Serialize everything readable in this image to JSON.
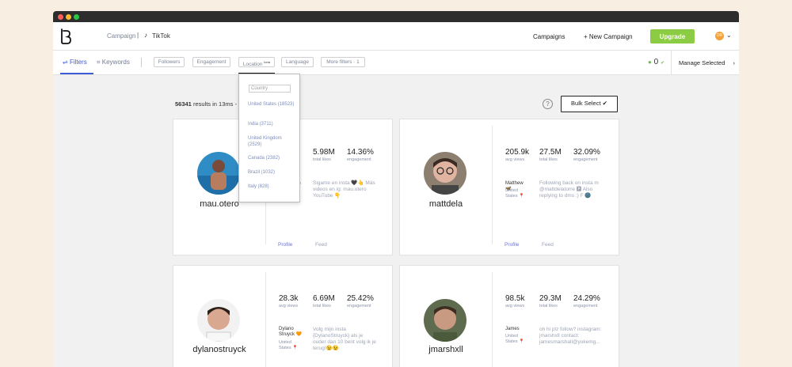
{
  "nav": {
    "crumb": "Campaign",
    "sep": "|",
    "platform": "TikTok",
    "campaigns": "Campaigns",
    "new_campaign": "+ New Campaign",
    "upgrade": "Upgrade",
    "avatar_initials": "DR"
  },
  "filters": {
    "tab_filters": "Filters",
    "tab_keywords": "Keywords",
    "chips": {
      "followers": "Followers",
      "engagement": "Engagement",
      "location": "Location",
      "location_badge": "beta",
      "language": "Language",
      "more": "More filters · 1"
    },
    "selected_count": "0",
    "manage": "Manage Selected"
  },
  "location_dropdown": {
    "placeholder": "Country",
    "options": [
      "United States (18523)",
      "India (3711)",
      "United Kingdom (2529)",
      "Canada (2382)",
      "Brazil (1032)",
      "Italy (828)"
    ]
  },
  "results": {
    "count": "56341",
    "text": " results in 13ms - F"
  },
  "help_label": "?",
  "bulk_select": "Bulk Select ✔",
  "cards": [
    {
      "handle": "mau.otero",
      "stats": [
        {
          "value": "5.98M",
          "label": "total likes"
        },
        {
          "value": "14.36%",
          "label": "engagement"
        }
      ],
      "name": "",
      "location": "o",
      "bio": "Sigame en insta 🖤👆 Más videos en ig: mau.otero YouTube 👇",
      "profile": "Profile",
      "feed": "Feed"
    },
    {
      "handle": "mattdela",
      "stats": [
        {
          "value": "205.9k",
          "label": "avg views"
        },
        {
          "value": "27.5M",
          "label": "total likes"
        },
        {
          "value": "32.09%",
          "label": "engagement"
        }
      ],
      "name": "Matthew🦋",
      "location": "United States 📍",
      "bio": "Following back on insta m @mattdelatorre 🅿 Also replying to dms :) F 🌚",
      "profile": "Profile",
      "feed": "Feed"
    },
    {
      "handle": "dylanostruyck",
      "stats": [
        {
          "value": "28.3k",
          "label": "avg views"
        },
        {
          "value": "6.69M",
          "label": "total likes"
        },
        {
          "value": "25.42%",
          "label": "engagement"
        }
      ],
      "name": "Dylano Struyck 🧡",
      "location": "United States 📍",
      "bio": "Volg mijn insta {DylanoStruyck} als je ouder dan 10 bent volg ik je terug!😉😉",
      "profile": "",
      "feed": ""
    },
    {
      "handle": "jmarshxll",
      "stats": [
        {
          "value": "98.5k",
          "label": "avg views"
        },
        {
          "value": "29.3M",
          "label": "total likes"
        },
        {
          "value": "24.29%",
          "label": "engagement"
        }
      ],
      "name": "James",
      "location": "United States 📍",
      "bio": "oh hi plz follow? instagram: jmarshxll contact: jamesmarshall@yokemg...",
      "profile": "",
      "feed": ""
    }
  ],
  "colors": {
    "accent": "#3e5bd6",
    "upgrade": "#8ccc45",
    "background": "#f8efe2"
  }
}
